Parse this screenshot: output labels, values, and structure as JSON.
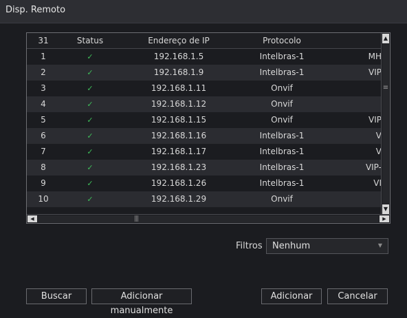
{
  "window": {
    "title": "Disp. Remoto"
  },
  "table": {
    "columns": [
      "31",
      "Status",
      "Endereço de IP",
      "Protocolo",
      ""
    ],
    "rows": [
      {
        "n": "1",
        "status": "✓",
        "ip": "192.168.1.5",
        "protocol": "Intelbras-1",
        "extra": "MH"
      },
      {
        "n": "2",
        "status": "✓",
        "ip": "192.168.1.9",
        "protocol": "Intelbras-1",
        "extra": "VIP"
      },
      {
        "n": "3",
        "status": "✓",
        "ip": "192.168.1.11",
        "protocol": "Onvif",
        "extra": ""
      },
      {
        "n": "4",
        "status": "✓",
        "ip": "192.168.1.12",
        "protocol": "Onvif",
        "extra": ""
      },
      {
        "n": "5",
        "status": "✓",
        "ip": "192.168.1.15",
        "protocol": "Onvif",
        "extra": "VIP"
      },
      {
        "n": "6",
        "status": "✓",
        "ip": "192.168.1.16",
        "protocol": "Intelbras-1",
        "extra": "V"
      },
      {
        "n": "7",
        "status": "✓",
        "ip": "192.168.1.17",
        "protocol": "Intelbras-1",
        "extra": "V"
      },
      {
        "n": "8",
        "status": "✓",
        "ip": "192.168.1.23",
        "protocol": "Intelbras-1",
        "extra": "VIP-"
      },
      {
        "n": "9",
        "status": "✓",
        "ip": "192.168.1.26",
        "protocol": "Intelbras-1",
        "extra": "VI"
      },
      {
        "n": "10",
        "status": "✓",
        "ip": "192.168.1.29",
        "protocol": "Onvif",
        "extra": ""
      }
    ]
  },
  "scroll": {
    "up_glyph": "▲",
    "down_glyph": "▼",
    "left_glyph": "◀",
    "right_glyph": "▶",
    "vthumb_glyph": "≡",
    "hthumb_glyph": "|||"
  },
  "filter": {
    "label": "Filtros",
    "value": "Nenhum",
    "caret": "▼"
  },
  "buttons": {
    "search": "Buscar",
    "add_manual": "Adicionar manualmente",
    "add": "Adicionar",
    "cancel": "Cancelar"
  },
  "colors": {
    "check": "#3fbf5a",
    "row_alt": "#2b2c31",
    "background": "#1b1c20"
  }
}
